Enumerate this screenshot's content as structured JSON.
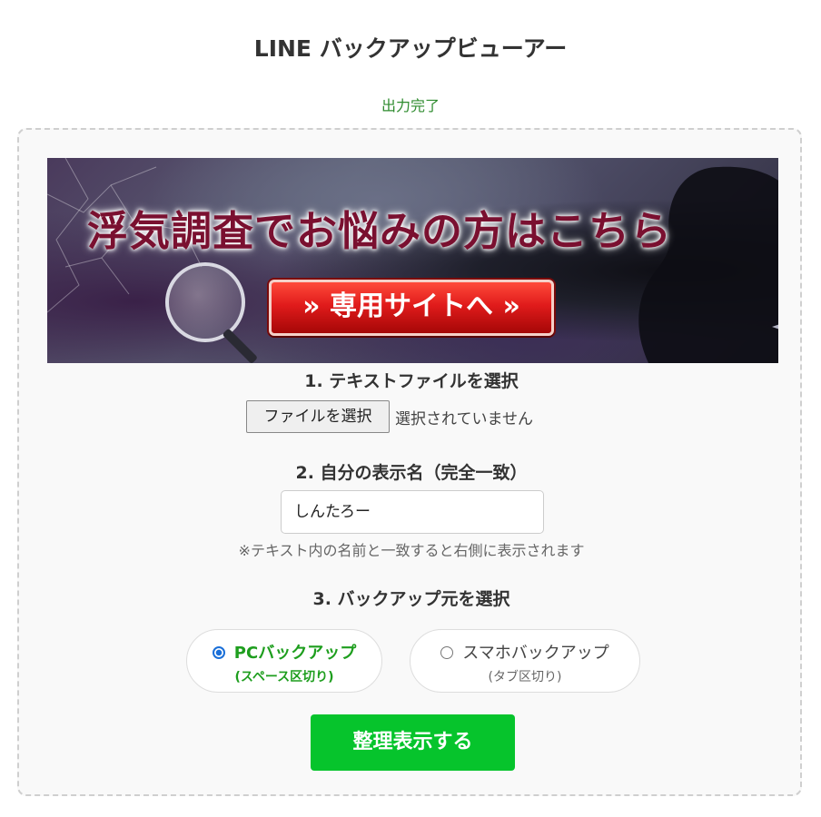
{
  "page": {
    "title": "LINE バックアップビューアー",
    "status": "出力完了"
  },
  "banner": {
    "headline": "浮気調査でお悩みの方はこちら",
    "cta": "» 専用サイトへ »"
  },
  "step1": {
    "label": "1. テキストファイルを選択",
    "button": "ファイルを選択",
    "status": "選択されていません"
  },
  "step2": {
    "label": "2. 自分の表示名（完全一致）",
    "value": "しんたろー",
    "note": "※テキスト内の名前と一致すると右側に表示されます"
  },
  "step3": {
    "label": "3. バックアップ元を選択",
    "options": [
      {
        "label": "PCバックアップ",
        "sub": "(スペース区切り)",
        "selected": true
      },
      {
        "label": "スマホバックアップ",
        "sub": "(タブ区切り)",
        "selected": false
      }
    ]
  },
  "submit": {
    "label": "整理表示する"
  },
  "colors": {
    "accent": "#06c42c",
    "status_text": "#2e8b2e",
    "radio_selected": "#1a6fd8"
  }
}
